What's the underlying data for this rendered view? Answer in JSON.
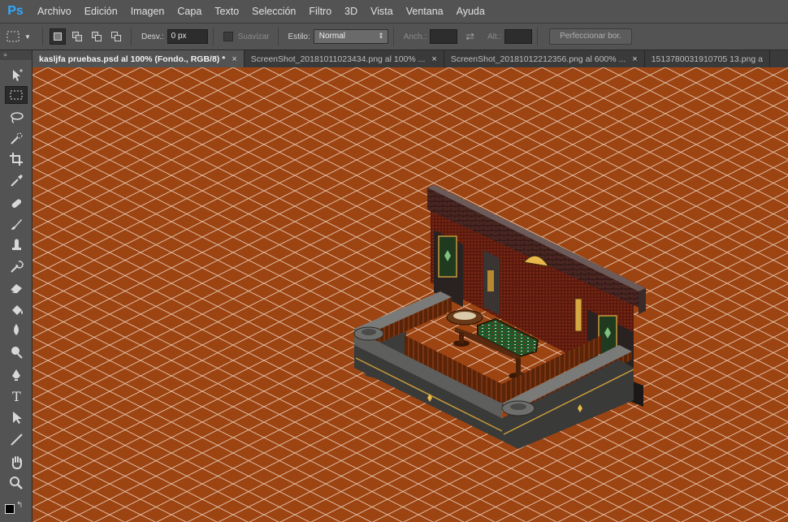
{
  "app": {
    "logo": "Ps"
  },
  "menu": [
    "Archivo",
    "Edición",
    "Imagen",
    "Capa",
    "Texto",
    "Selección",
    "Filtro",
    "3D",
    "Vista",
    "Ventana",
    "Ayuda"
  ],
  "options": {
    "feather_label": "Desv.:",
    "feather_value": "0 px",
    "antialias_label": "Suavizar",
    "style_label": "Estilo:",
    "style_value": "Normal",
    "width_label": "Anch.:",
    "height_label": "Alt.:",
    "refine_label": "Perfeccionar bor."
  },
  "tabs": [
    {
      "label": "kasljfa pruebas.psd al 100% (Fondo., RGB/8) *",
      "close": "×",
      "active": true
    },
    {
      "label": "ScreenShot_20181011023434.png al 100% ...",
      "close": "×",
      "active": false
    },
    {
      "label": "ScreenShot_20181012212356.png al 600% ...",
      "close": "×",
      "active": false
    },
    {
      "label": "1513780031910705 13.png a",
      "close": "",
      "active": false
    }
  ],
  "toolbox": {
    "tools": [
      "move-tool",
      "marquee-tool",
      "lasso-tool",
      "quick-selection-tool",
      "crop-tool",
      "eyedropper-tool",
      "healing-brush-tool",
      "brush-tool",
      "clone-stamp-tool",
      "history-brush-tool",
      "eraser-tool",
      "paint-bucket-tool",
      "blur-tool",
      "dodge-tool",
      "pen-tool",
      "type-tool",
      "path-selection-tool",
      "line-tool",
      "hand-tool",
      "zoom-tool"
    ],
    "active_tool": "marquee-tool",
    "type_glyph": "T"
  },
  "colors": {
    "canvas_floor": "#9d4413",
    "grid_line": "#e8c9b0",
    "ui_panel": "#535353",
    "ps_blue": "#31a8ff"
  }
}
